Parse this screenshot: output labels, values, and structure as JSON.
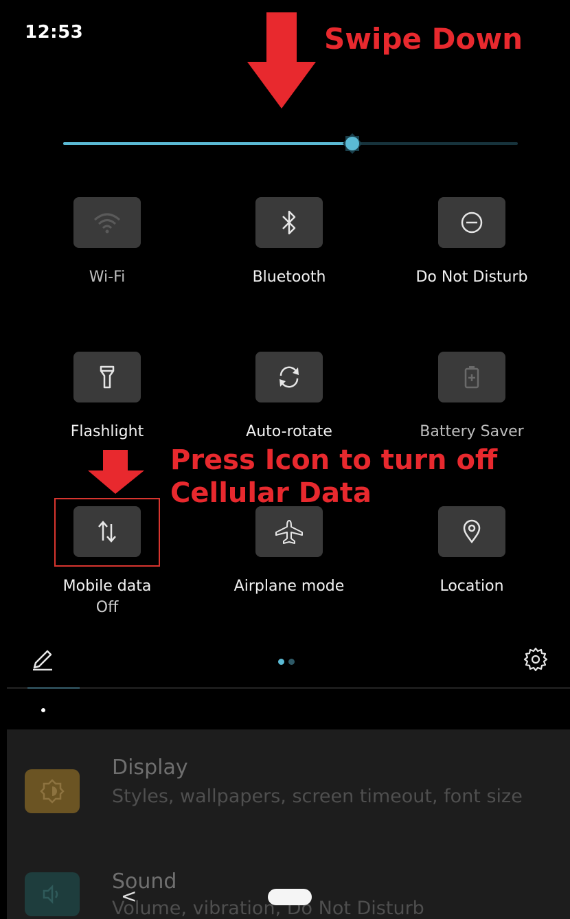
{
  "status_bar": {
    "time": "12:53"
  },
  "annotations": {
    "swipe": "Swipe Down",
    "press_line1": "Press Icon to turn off",
    "press_line2": "Cellular Data",
    "arrow_color": "#e8292e"
  },
  "brightness": {
    "level": 0.63,
    "accent": "#5bbad4"
  },
  "tiles": [
    {
      "label": "Wi-Fi",
      "icon": "wifi-icon"
    },
    {
      "label": "Bluetooth",
      "icon": "bluetooth-icon"
    },
    {
      "label": "Do Not Disturb",
      "icon": "do-not-disturb-icon"
    },
    {
      "label": "Flashlight",
      "icon": "flashlight-icon"
    },
    {
      "label": "Auto-rotate",
      "icon": "auto-rotate-icon"
    },
    {
      "label": "Battery Saver",
      "icon": "battery-saver-icon"
    },
    {
      "label": "Mobile data",
      "sub": "Off",
      "icon": "mobile-data-icon"
    },
    {
      "label": "Airplane mode",
      "icon": "airplane-icon"
    },
    {
      "label": "Location",
      "icon": "location-icon"
    }
  ],
  "qs_footer": {
    "edit_icon": "pencil-icon",
    "settings_icon": "gear-icon",
    "pages": 2,
    "current_page": 1
  },
  "settings_list": [
    {
      "title": "Display",
      "desc": "Styles, wallpapers, screen timeout, font size",
      "icon": "display-icon",
      "color": "#6b5423"
    },
    {
      "title": "Sound",
      "desc": "Volume, vibration, Do Not Disturb",
      "icon": "sound-icon",
      "color": "#1e3d3d"
    }
  ],
  "nav": {
    "back": "<"
  }
}
